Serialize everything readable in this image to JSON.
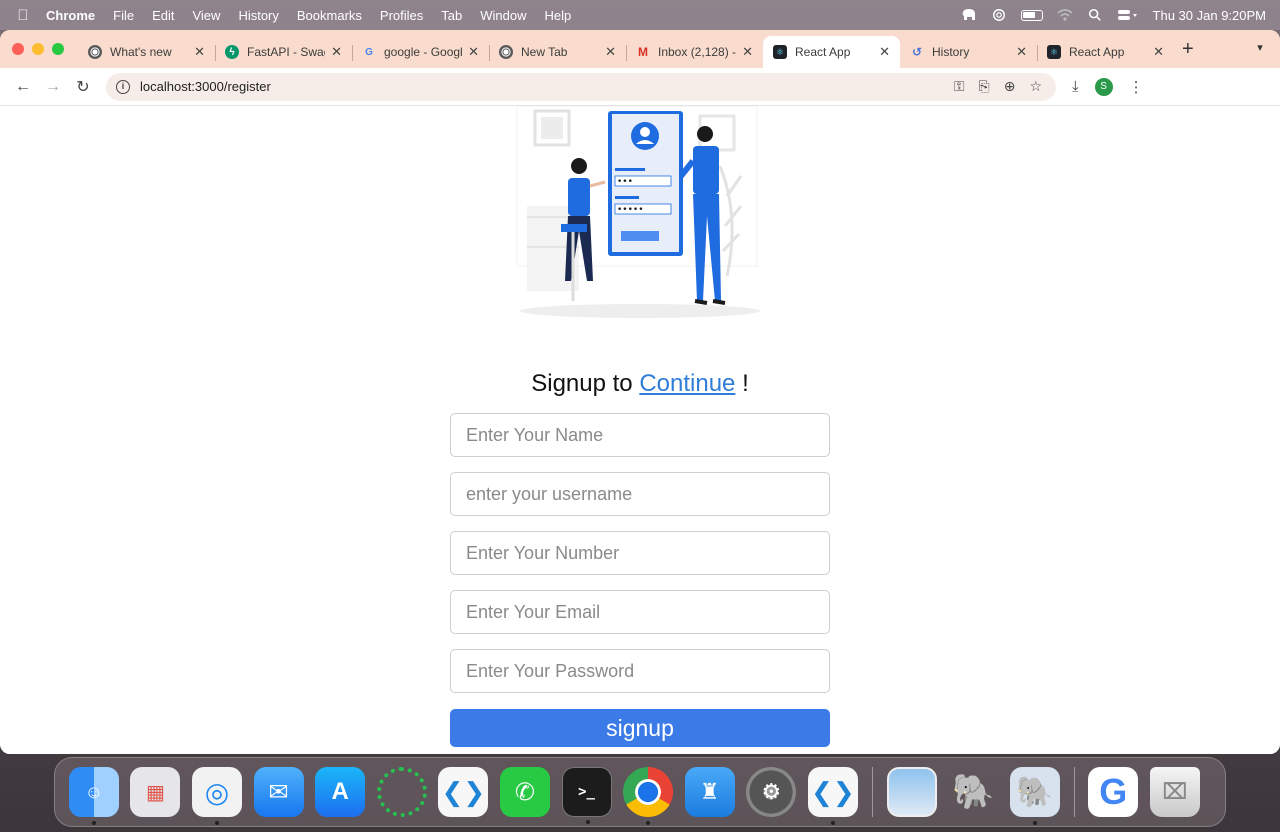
{
  "menubar": {
    "app_name": "Chrome",
    "menus": [
      "File",
      "Edit",
      "View",
      "History",
      "Bookmarks",
      "Profiles",
      "Tab",
      "Window",
      "Help"
    ],
    "datetime": "Thu 30 Jan  9:20PM"
  },
  "tabs": [
    {
      "title": "What's new",
      "favicon": "chrome-icon"
    },
    {
      "title": "FastAPI - Swagger",
      "favicon": "fastapi-icon"
    },
    {
      "title": "google - Google",
      "favicon": "google-icon"
    },
    {
      "title": "New Tab",
      "favicon": "chrome-icon"
    },
    {
      "title": "Inbox (2,128) -",
      "favicon": "gmail-icon"
    },
    {
      "title": "React App",
      "favicon": "react-icon",
      "active": true
    },
    {
      "title": "History",
      "favicon": "history-icon"
    },
    {
      "title": "React App",
      "favicon": "react-icon"
    }
  ],
  "toolbar": {
    "url": "localhost:3000/register",
    "profile_initial": "S"
  },
  "page": {
    "title_prefix": "Signup to ",
    "title_link": "Continue",
    "title_suffix": " !",
    "fields": {
      "name_placeholder": "Enter Your Name",
      "username_placeholder": "enter your username",
      "number_placeholder": "Enter Your Number",
      "email_placeholder": "Enter Your Email",
      "password_placeholder": "Enter Your Password"
    },
    "signup_label": "signup"
  },
  "dock": {
    "apps": [
      "Finder",
      "Launchpad",
      "Safari",
      "Mail",
      "App Store",
      "Cursor",
      "VS Code",
      "WhatsApp",
      "Terminal",
      "Chrome",
      "Keynote",
      "System Settings",
      "VS Code",
      "Preview",
      "TablePlus",
      "pgAdmin",
      "Google",
      "Trash"
    ]
  },
  "colors": {
    "accent": "#3a7be8",
    "link": "#2f7ed8",
    "tabstrip": "#f9dccd"
  }
}
